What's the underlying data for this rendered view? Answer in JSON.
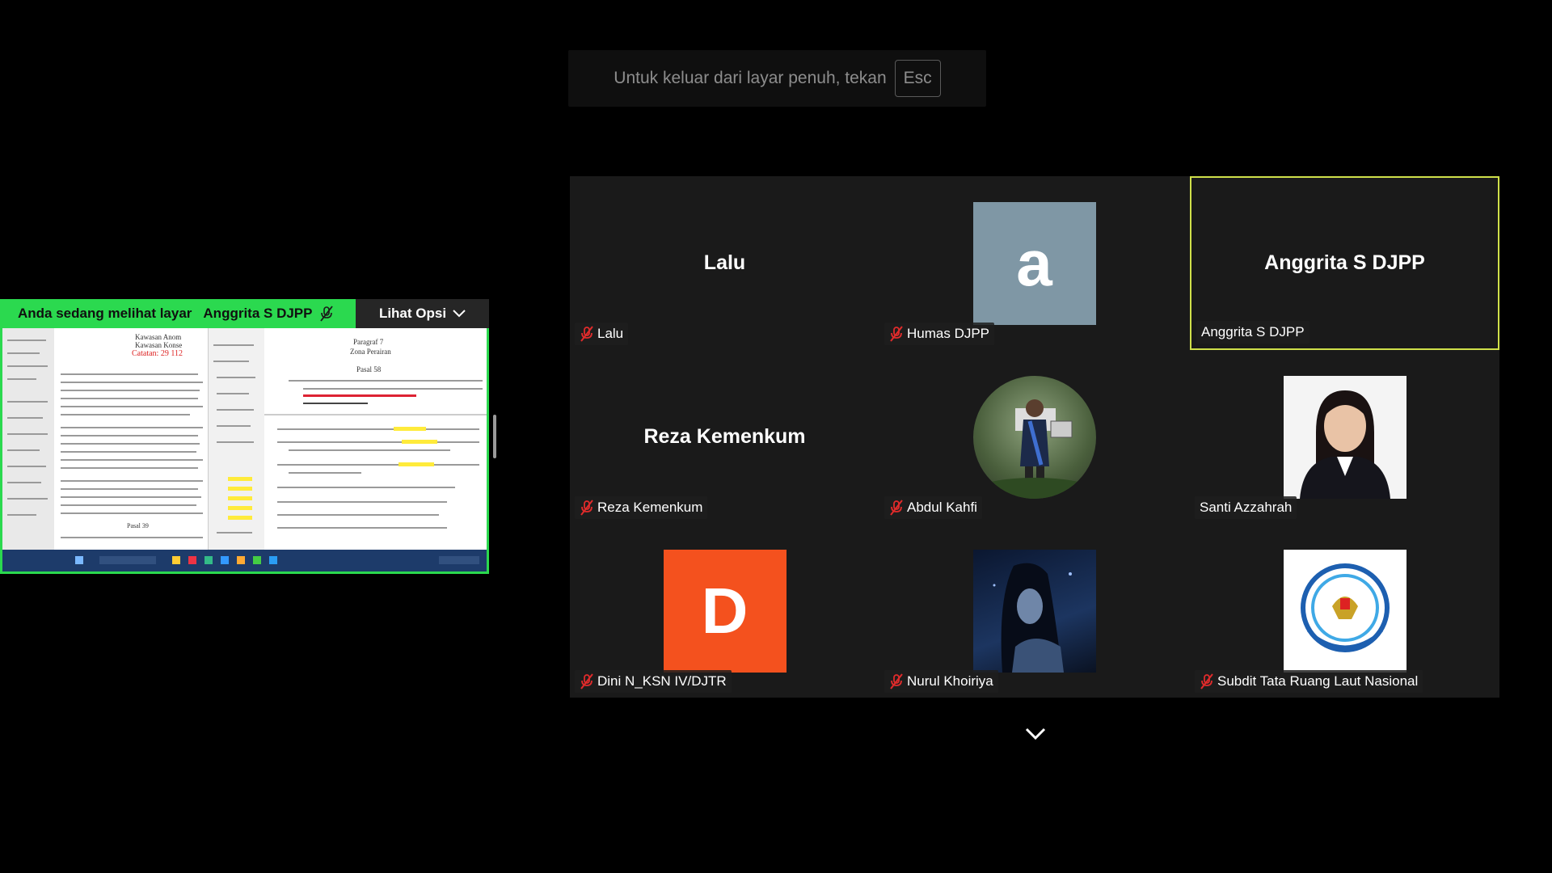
{
  "fullscreen_hint": {
    "text": "Untuk keluar dari layar penuh, tekan",
    "key": "Esc"
  },
  "screen_share": {
    "viewing_label": "Anda sedang melihat layar",
    "presenter": "Anggrita S DJPP",
    "options_label": "Lihat Opsi",
    "doc_text": {
      "title_left": "Kawasan Anom",
      "title_left2": "Kawasan Konse",
      "red_text": "Catatan: 29 112",
      "heading_right": "Paragraf 7",
      "heading_right2": "Zona Perairan",
      "pasal": "Pasal 58",
      "pasal_bottom": "Pasal 39"
    }
  },
  "gallery": {
    "tiles": [
      {
        "center_text": "Lalu",
        "name": "Lalu",
        "muted": true,
        "avatar": "none",
        "speaking": false
      },
      {
        "center_text": "a",
        "name": "Humas DJPP",
        "muted": true,
        "avatar": "letter-a",
        "speaking": false
      },
      {
        "center_text": "Anggrita S DJPP",
        "name": "Anggrita S DJPP",
        "muted": false,
        "avatar": "none",
        "speaking": true
      },
      {
        "center_text": "Reza Kemenkum",
        "name": "Reza Kemenkum",
        "muted": true,
        "avatar": "none",
        "speaking": false
      },
      {
        "center_text": "",
        "name": "Abdul Kahfi",
        "muted": true,
        "avatar": "photo-circle",
        "speaking": false
      },
      {
        "center_text": "",
        "name": "Santi Azzahrah",
        "muted": false,
        "avatar": "photo-portrait",
        "speaking": false
      },
      {
        "center_text": "D",
        "name": "Dini N_KSN IV/DJTR",
        "muted": true,
        "avatar": "letter-d",
        "speaking": false
      },
      {
        "center_text": "",
        "name": "Nurul Khoiriya",
        "muted": true,
        "avatar": "photo-anime",
        "speaking": false
      },
      {
        "center_text": "",
        "name": "Subdit Tata Ruang Laut Nasional",
        "muted": true,
        "avatar": "logo",
        "speaking": false
      }
    ]
  },
  "colors": {
    "share_green": "#2bd94f",
    "speaking_border": "#cfe04a",
    "mute_red": "#e02b2b",
    "avatar_d": "#f4511e",
    "avatar_a": "#7f97a5"
  }
}
